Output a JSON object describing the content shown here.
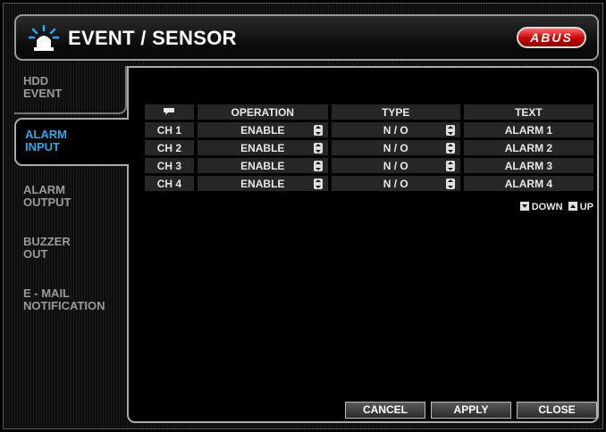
{
  "header": {
    "title": "EVENT / SENSOR",
    "logo": "ABUS"
  },
  "sidebar": {
    "items": [
      {
        "line1": "HDD",
        "line2": "EVENT"
      },
      {
        "line1": "ALARM",
        "line2": "INPUT"
      },
      {
        "line1": "ALARM",
        "line2": "OUTPUT"
      },
      {
        "line1": "BUZZER",
        "line2": "OUT"
      },
      {
        "line1": "E - MAIL",
        "line2": "NOTIFICATION"
      }
    ],
    "active_index": 1
  },
  "table": {
    "columns": {
      "operation": "OPERATION",
      "type": "TYPE",
      "text": "TEXT"
    },
    "rows": [
      {
        "channel": "CH 1",
        "operation": "ENABLE",
        "type": "N / O",
        "text": "ALARM 1"
      },
      {
        "channel": "CH 2",
        "operation": "ENABLE",
        "type": "N / O",
        "text": "ALARM 2"
      },
      {
        "channel": "CH 3",
        "operation": "ENABLE",
        "type": "N / O",
        "text": "ALARM 3"
      },
      {
        "channel": "CH 4",
        "operation": "ENABLE",
        "type": "N / O",
        "text": "ALARM 4"
      }
    ]
  },
  "nav": {
    "down": "DOWN",
    "up": "UP"
  },
  "buttons": {
    "cancel": "CANCEL",
    "apply": "APPLY",
    "close": "CLOSE"
  },
  "colors": {
    "accent": "#2ea8e6",
    "logo": "#c80000"
  }
}
